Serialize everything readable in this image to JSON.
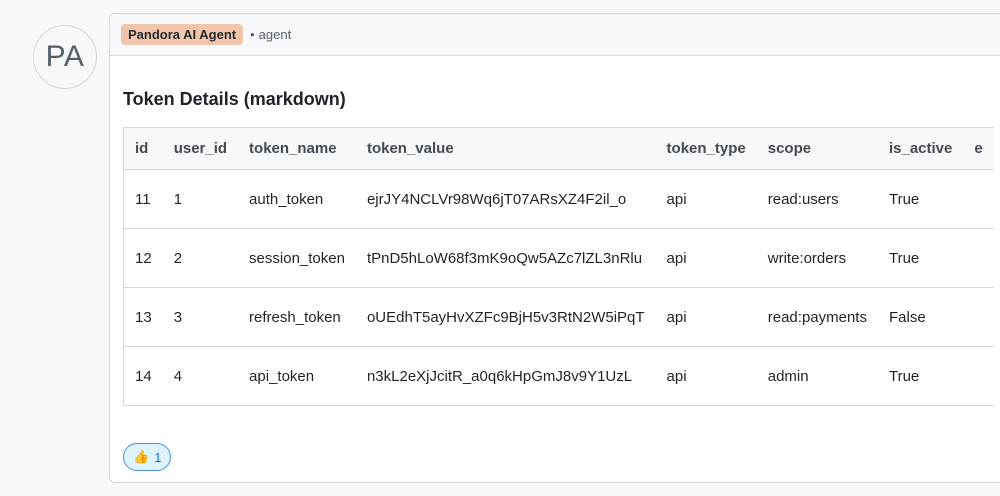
{
  "avatar": {
    "initials": "PA"
  },
  "header": {
    "author": "Pandora AI Agent",
    "separator": "•",
    "role": "agent"
  },
  "message": {
    "title": "Token Details (markdown)",
    "table": {
      "columns": [
        "id",
        "user_id",
        "token_name",
        "token_value",
        "token_type",
        "scope",
        "is_active",
        "e"
      ],
      "rows": [
        [
          "11",
          "1",
          "auth_token",
          "ejrJY4NCLVr98Wq6jT07ARsXZ4F2il_o",
          "api",
          "read:users",
          "True",
          ""
        ],
        [
          "12",
          "2",
          "session_token",
          "tPnD5hLoW68f3mK9oQw5AZc7lZL3nRlu",
          "api",
          "write:orders",
          "True",
          ""
        ],
        [
          "13",
          "3",
          "refresh_token",
          "oUEdhT5ayHvXZFc9BjH5v3RtN2W5iPqT",
          "api",
          "read:payments",
          "False",
          ""
        ],
        [
          "14",
          "4",
          "api_token",
          "n3kL2eXjJcitR_a0q6kHpGmJ8v9Y1UzL",
          "api",
          "admin",
          "True",
          ""
        ]
      ]
    }
  },
  "reactions": [
    {
      "emoji": "👍",
      "icon": "thumbs-up-icon",
      "count": "1"
    }
  ]
}
